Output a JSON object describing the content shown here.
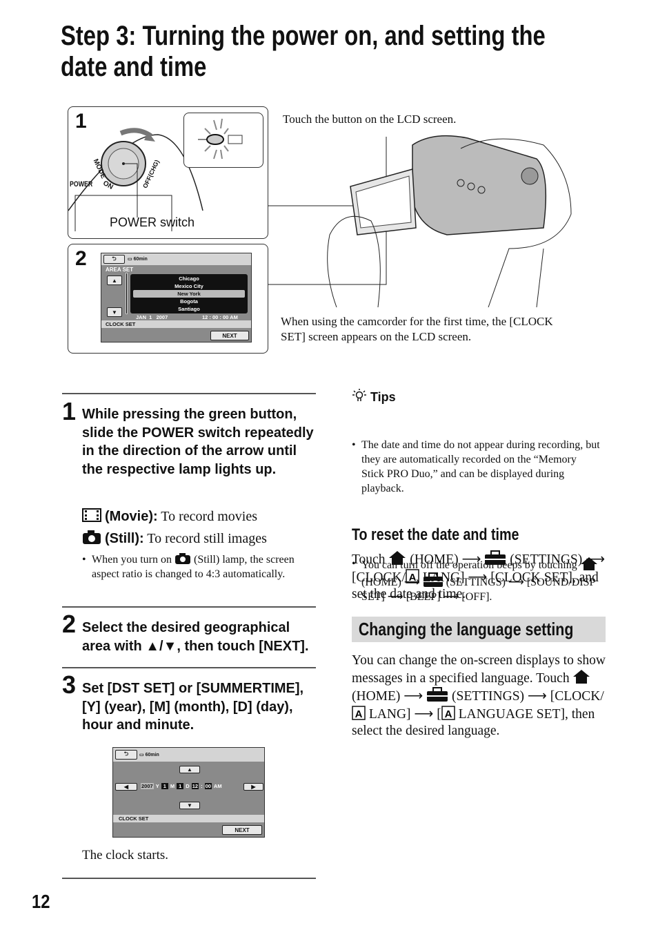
{
  "title": {
    "line1": "Step 3: Turning the power on, and setting the",
    "line2": "date and time"
  },
  "figure": {
    "panel1": {
      "number": "1",
      "power_label": "POWER",
      "mode_label": "MODE",
      "on_label": "ON",
      "off_label": "OFF(CHG)",
      "switch_caption": "POWER switch"
    },
    "panel2": {
      "number": "2",
      "battery": "60min",
      "area_set": "AREA SET",
      "cities": [
        "Chicago",
        "Mexico City",
        "New York",
        "Bogota",
        "Santiago"
      ],
      "selected_city": "New York",
      "date": "JAN  1   2007",
      "time": "12 : 00 : 00 AM",
      "clock_set": "CLOCK SET",
      "next": "NEXT"
    },
    "callout_touch": "Touch the button on the LCD screen.",
    "callout_first_time": "When using the camcorder for the first time, the [CLOCK SET] screen appears on the LCD screen."
  },
  "steps": [
    {
      "number": "1",
      "text": "While pressing the green button, slide the POWER switch repeatedly in the direction of the arrow until the respective lamp lights up.",
      "movie_label": "(Movie):",
      "movie_desc": " To record movies",
      "still_label": "(Still):",
      "still_desc": " To record still images",
      "note_a": "When you turn on ",
      "note_b": " (Still) lamp, the screen aspect ratio is changed to 4:3 automatically."
    },
    {
      "number": "2",
      "text": "Select the desired geographical area with ▲/▼, then touch [NEXT]."
    },
    {
      "number": "3",
      "text": "Set [DST SET] or [SUMMERTIME], [Y] (year), [M] (month), [D] (day), hour and minute.",
      "screen": {
        "battery": "60min",
        "year": "2007",
        "y": "Y",
        "month": "1",
        "m": "M",
        "day": "1",
        "d": "D",
        "hour": "12",
        "colon": ":",
        "minute": "00",
        "ampm": "AM",
        "clock_set": "CLOCK SET",
        "next": "NEXT"
      },
      "caption": "The clock starts."
    }
  ],
  "tips": {
    "heading": "Tips",
    "tip1": "The date and time do not appear during recording, but they are automatically recorded on the “Memory Stick PRO Duo,” and can be displayed during playback.",
    "tip2_a": "You can turn off the operation beeps by touching ",
    "tip2_b": " (HOME) ⟶ ",
    "tip2_c": " (SETTINGS) ⟶ [SOUND/DISP SET] ⟶ [BEEP] ⟶ [OFF]."
  },
  "reset": {
    "heading": "To reset the date and time",
    "a": "Touch ",
    "b": " (HOME) ⟶ ",
    "c": " (SETTINGS) ⟶ [CLOCK/",
    "d": " LANG] ⟶ [CLOCK SET], and set the date and time."
  },
  "language": {
    "heading": "Changing the language setting",
    "a": "You can change the on-screen displays to show messages in a specified language. Touch ",
    "b": " (HOME) ⟶ ",
    "c": " (SETTINGS) ⟶ [CLOCK/",
    "d": " LANG] ⟶ [",
    "e": " LANGUAGE SET], then select the desired language."
  },
  "page_number": "12"
}
